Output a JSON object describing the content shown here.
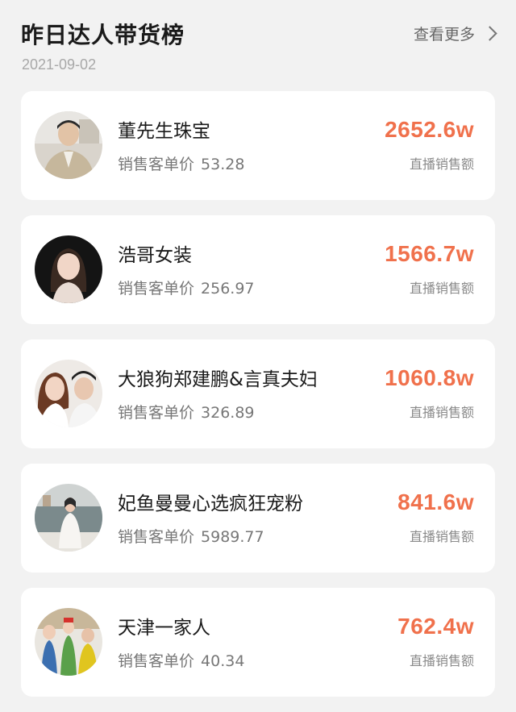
{
  "header": {
    "title": "昨日达人带货榜",
    "date": "2021-09-02",
    "more_label": "查看更多"
  },
  "colors": {
    "accent": "#f0714c",
    "background": "#f2f2f2",
    "card": "#ffffff"
  },
  "ranking": [
    {
      "name": "董先生珠宝",
      "unit_price_label": "销售客单价",
      "unit_price": "53.28",
      "amount": "2652.6w",
      "amount_label": "直播销售额"
    },
    {
      "name": "浩哥女装",
      "unit_price_label": "销售客单价",
      "unit_price": "256.97",
      "amount": "1566.7w",
      "amount_label": "直播销售额"
    },
    {
      "name": "大狼狗郑建鹏&言真夫妇",
      "unit_price_label": "销售客单价",
      "unit_price": "326.89",
      "amount": "1060.8w",
      "amount_label": "直播销售额"
    },
    {
      "name": "妃鱼曼曼心选疯狂宠粉",
      "unit_price_label": "销售客单价",
      "unit_price": "5989.77",
      "amount": "841.6w",
      "amount_label": "直播销售额"
    },
    {
      "name": "天津一家人",
      "unit_price_label": "销售客单价",
      "unit_price": "40.34",
      "amount": "762.4w",
      "amount_label": "直播销售额"
    }
  ]
}
